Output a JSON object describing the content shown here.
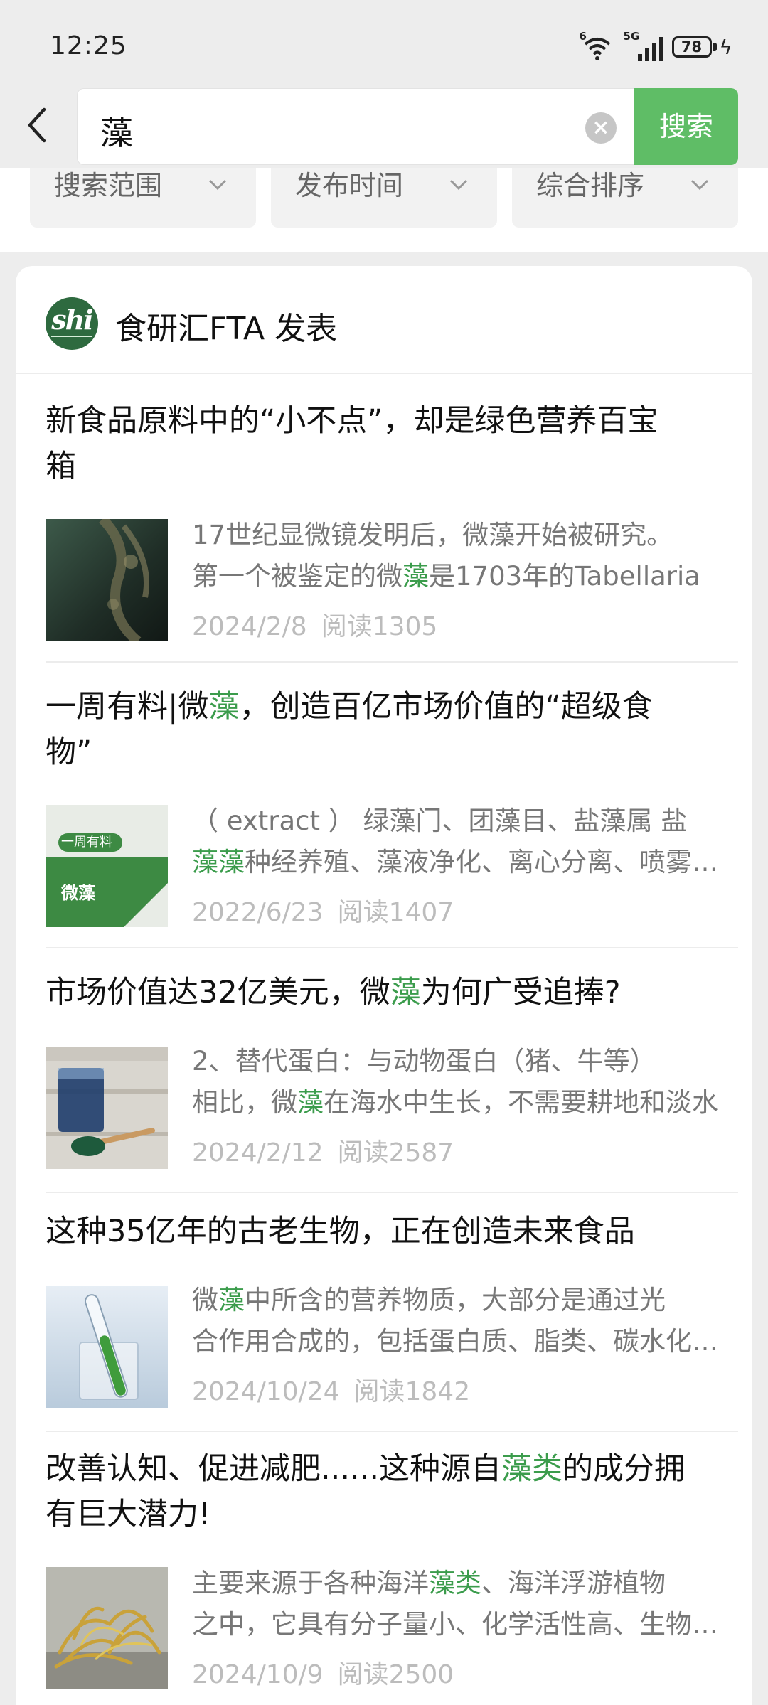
{
  "status_bar": {
    "time": "12:25",
    "net_label": "5G",
    "wifi_label": "6",
    "battery": "78"
  },
  "search": {
    "query": "藻",
    "submit_label": "搜索"
  },
  "filters": [
    {
      "label": "搜索范围"
    },
    {
      "label": "发布时间"
    },
    {
      "label": "综合排序"
    }
  ],
  "source": {
    "name": "食研汇FTA 发表",
    "logo_text": "shi"
  },
  "articles": [
    {
      "title": {
        "a": "新食品原料中的“小不点”，却是绿色营养百宝",
        "b": "箱"
      },
      "thumb": "microalgae-dark",
      "excerpt": {
        "line1": "17世纪显微镜发明后，微藻开始被研究。",
        "line2_a": "第一个被鉴定的微",
        "line2_hl": "藻",
        "line2_b": "是1703年的Tabellaria"
      },
      "date": "2024/2/8",
      "reads": "阅读1305"
    },
    {
      "title": {
        "a": "一周有料|微",
        "hl": "藻",
        "b": "，创造百亿市场价值的“超级食",
        "c": "物”"
      },
      "thumb": "weekly-card",
      "thumb_text": {
        "line1": "一周有料",
        "line2": "微藻"
      },
      "excerpt": {
        "line1": "（ extract ） 绿藻门、团藻目、盐藻属 盐",
        "line2_hl": "藻藻",
        "line2_b": "种经养殖、藻液净化、离心分离、喷雾干燥"
      },
      "date": "2022/6/23",
      "reads": "阅读1407"
    },
    {
      "title": {
        "a": "市场价值达32亿美元，微",
        "hl": "藻",
        "b": "为何广受追捧?"
      },
      "thumb": "spirulina-glass",
      "excerpt": {
        "line1": "2、替代蛋白：与动物蛋白（猪、牛等）",
        "line2_a": "相比，微",
        "line2_hl": "藻",
        "line2_b": "在海水中生长，不需要耕地和淡水"
      },
      "date": "2024/2/12",
      "reads": "阅读2587"
    },
    {
      "title": {
        "a": "这种35亿年的古老生物，正在创造未来食品"
      },
      "thumb": "test-tube",
      "excerpt": {
        "line1_a": "微",
        "line1_hl": "藻",
        "line1_b": "中所含的营养物质，大部分是通过光",
        "line2": "合作用合成的，包括蛋白质、脂类、碳水化合物"
      },
      "date": "2024/10/24",
      "reads": "阅读1842"
    },
    {
      "title": {
        "a": "改善认知、促进减肥......这种源自",
        "hl": "藻类",
        "b": "的成分拥",
        "c": "有巨大潜力!"
      },
      "thumb": "seaweed",
      "excerpt": {
        "line1_a": "主要来源于各种海洋",
        "line1_hl": "藻类",
        "line1_b": "、海洋浮游植物",
        "line2": "之中，它具有分子量小、化学活性高、生物利用度高"
      },
      "date": "2024/10/9",
      "reads": "阅读2500"
    }
  ],
  "colors": {
    "accent": "#5fbd66",
    "highlight": "#3b9c4c",
    "logo": "#2e6a3f"
  }
}
